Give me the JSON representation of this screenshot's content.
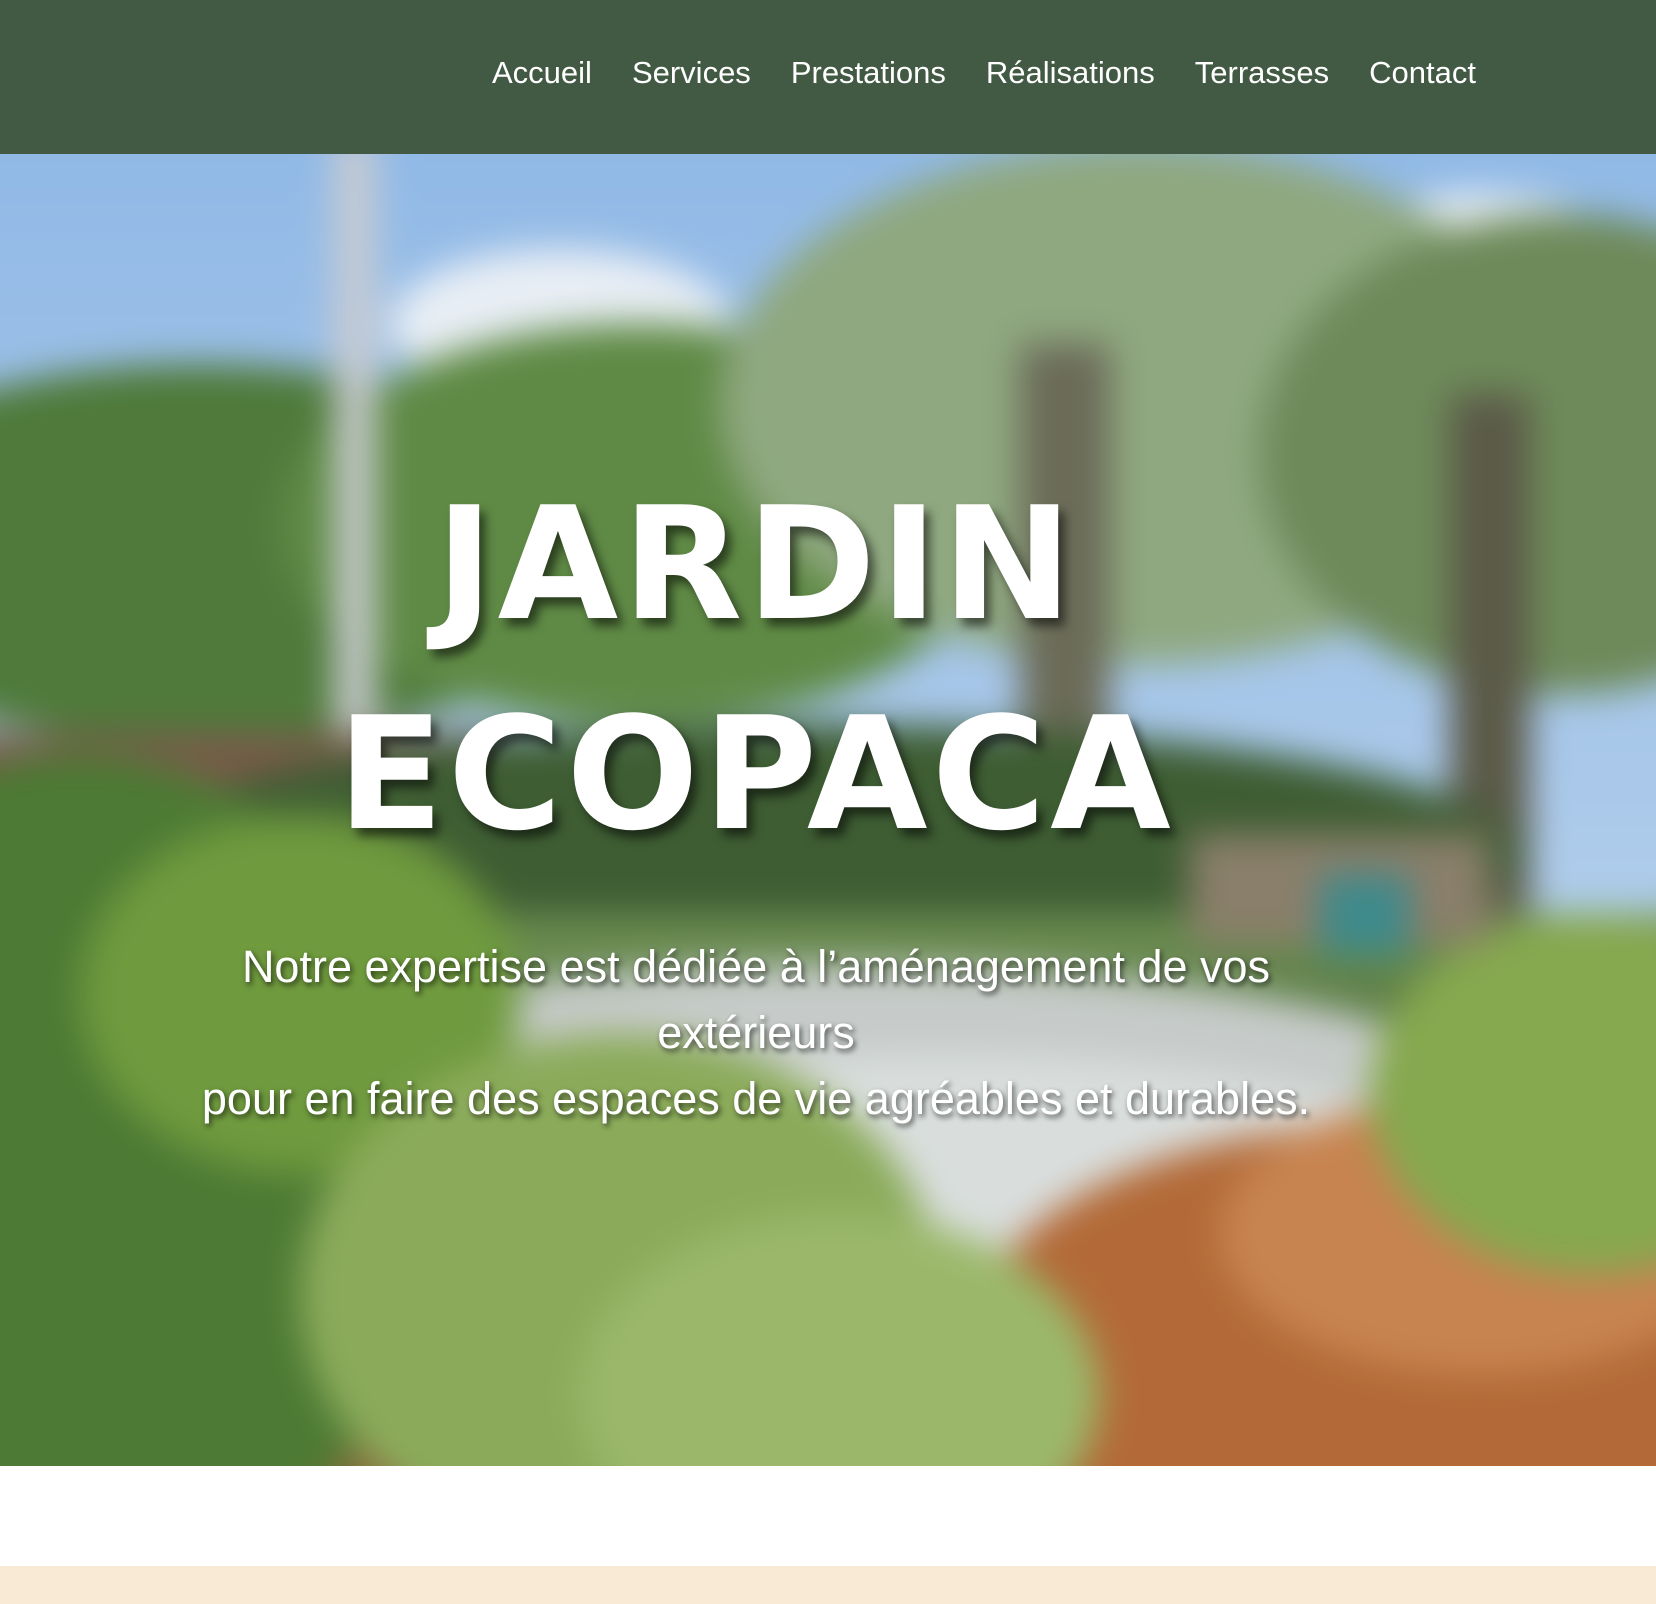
{
  "nav": {
    "items": [
      {
        "label": "Accueil"
      },
      {
        "label": "Services"
      },
      {
        "label": "Prestations"
      },
      {
        "label": "Réalisations"
      },
      {
        "label": "Terrasses"
      },
      {
        "label": "Contact"
      }
    ]
  },
  "hero": {
    "title_line1": "JARDIN",
    "title_line2": "ECOPACA",
    "text_line1": "Notre expertise est dédiée à l’aménagement de vos",
    "text_line2": "extérieurs",
    "text_line3": "pour en faire des espaces de vie agréables et durables."
  },
  "colors": {
    "nav_background": "#425a44",
    "nav_text": "#ffffff",
    "hero_text": "#ffffff",
    "page_background": "#ffffff",
    "cream_band": "#f8ead5"
  }
}
